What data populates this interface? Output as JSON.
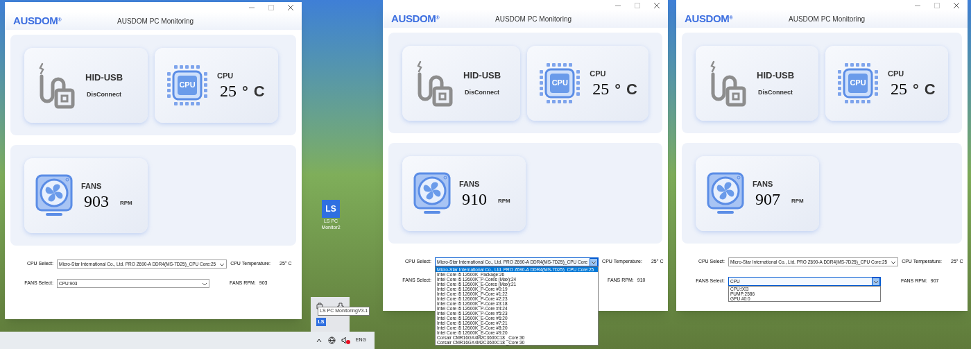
{
  "panels": [
    {
      "window": {
        "logo": "AUSDOM$^{®}$",
        "title": "AUSDOM PC Monitoring",
        "usb": {
          "title": "HID-USB",
          "status": "DisConnect"
        },
        "cpu": {
          "title": "CPU",
          "chip_label": "CPU",
          "value": "25",
          "degree": "°",
          "unit": "C"
        },
        "fans": {
          "title": "FANS",
          "value": "903",
          "unit": "RPM"
        },
        "cpu_select": {
          "label": "CPU Select:",
          "value": "Micro-Star International Co., Ltd. PRO Z690-A DDR4(MS-7D25)_CPU Core:25",
          "open": false
        },
        "cpu_temperature": {
          "label": "CPU Temperature:",
          "value": "25° C"
        },
        "fans_select": {
          "label": "FANS Select:",
          "value": "CPU:903",
          "open": false
        },
        "fans_rpm": {
          "label": "FANS RPM:",
          "value": "903"
        }
      },
      "desktop_icon": {
        "badge": "LS",
        "label": "LS PC Monitor2"
      },
      "tray": {
        "tooltip": "LS PC MonitoringV3.1",
        "app_badge": "LS"
      },
      "taskbar": {
        "language": "ENG"
      }
    },
    {
      "window": {
        "logo": "AUSDOM$^{®}$",
        "title": "AUSDOM PC Monitoring",
        "usb": {
          "title": "HID-USB",
          "status": "DisConnect"
        },
        "cpu": {
          "title": "CPU",
          "chip_label": "CPU",
          "value": "25",
          "degree": "°",
          "unit": "C"
        },
        "fans": {
          "title": "FANS",
          "value": "910",
          "unit": "RPM"
        },
        "cpu_select": {
          "label": "CPU Select:",
          "value": "Micro-Star International Co., Ltd. PRO Z690-A DDR4(MS-7D25)_CPU Core",
          "open": true,
          "options": [
            {
              "label": "Micro-Star International Co., Ltd. PRO Z690-A DDR4(MS-7D25)_CPU Core:25",
              "selected": true
            },
            {
              "label": "Intel Core i5 12600K_Package:26",
              "selected": false
            },
            {
              "label": "Intel Core i5 12600K_P-Cores (Max):24",
              "selected": false
            },
            {
              "label": "Intel Core i5 12600K_E-Cores (Max):21",
              "selected": false
            },
            {
              "label": "Intel Core i5 12600K_P-Core #0:19",
              "selected": false
            },
            {
              "label": "Intel Core i5 12600K_P-Core #1:22",
              "selected": false
            },
            {
              "label": "Intel Core i5 12600K_P-Core #2:23",
              "selected": false
            },
            {
              "label": "Intel Core i5 12600K_P-Core #3:18",
              "selected": false
            },
            {
              "label": "Intel Core i5 12600K_P-Core #4:24",
              "selected": false
            },
            {
              "label": "Intel Core i5 12600K_P-Core #5:23",
              "selected": false
            },
            {
              "label": "Intel Core i5 12600K_E-Core #6:20",
              "selected": false
            },
            {
              "label": "Intel Core i5 12600K_E-Core #7:21",
              "selected": false
            },
            {
              "label": "Intel Core i5 12600K_E-Core #8:20",
              "selected": false
            },
            {
              "label": "Intel Core i5 12600K_E-Core #9:20",
              "selected": false
            },
            {
              "label": "Corsair CMR16GX4M2C3600C18 _Core:30",
              "selected": false
            },
            {
              "label": "Corsair CMR16GX4M2C3600C18 _Core:30",
              "selected": false
            }
          ]
        },
        "cpu_temperature": {
          "label": "CPU Temperature:",
          "value": "25° C"
        },
        "fans_select": {
          "label": "FANS Select:"
        },
        "fans_rpm": {
          "label": "FANS RPM:",
          "value": "910"
        }
      }
    },
    {
      "window": {
        "logo": "AUSDOM$^{®}$",
        "title": "AUSDOM PC Monitoring",
        "usb": {
          "title": "HID-USB",
          "status": "DisConnect"
        },
        "cpu": {
          "title": "CPU",
          "chip_label": "CPU",
          "value": "25",
          "degree": "°",
          "unit": "C"
        },
        "fans": {
          "title": "FANS",
          "value": "907",
          "unit": "RPM"
        },
        "cpu_select": {
          "label": "CPU Select:",
          "value": "Micro-Star International Co., Ltd. PRO Z690-A DDR4(MS-7D25)_CPU Core:25",
          "open": false
        },
        "cpu_temperature": {
          "label": "CPU Temperature:",
          "value": "25° C"
        },
        "fans_select": {
          "label": "FANS Select:",
          "value": "CPU",
          "open": true,
          "options": [
            {
              "label": "CPU:903",
              "selected": false
            },
            {
              "label": "PUMP:2586",
              "selected": false
            },
            {
              "label": "GPU #0:0",
              "selected": false
            }
          ]
        },
        "fans_rpm": {
          "label": "FANS RPM:",
          "value": "907"
        }
      }
    }
  ]
}
